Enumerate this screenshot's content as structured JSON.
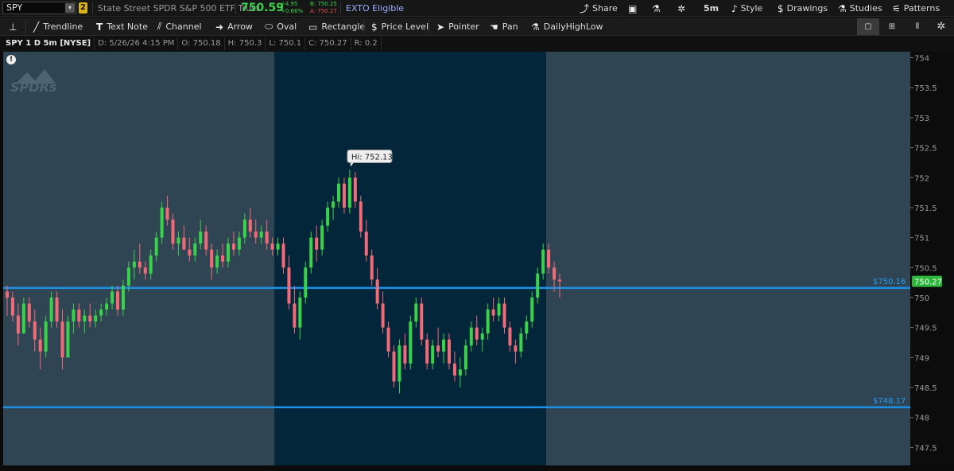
{
  "header": {
    "symbol": "SPY",
    "link_group": "2",
    "description": "State Street SPDR S&P 500 ETF Trust",
    "last_price": "750.59",
    "net_change": "+4.95",
    "pct_change": "+0.66%",
    "bid": "B: 750.25",
    "ask": "A: 750.27",
    "exto": "EXTO Eligible",
    "buttons": {
      "share": "Share",
      "timeframe": "5m",
      "style": "Style",
      "drawings": "Drawings",
      "studies": "Studies",
      "patterns": "Patterns"
    }
  },
  "drawing_tools": [
    {
      "name": "pin-tool",
      "icon": "pin-icon",
      "label": ""
    },
    {
      "name": "trendline-tool",
      "icon": "trendline-icon",
      "label": "Trendline"
    },
    {
      "name": "text-note-tool",
      "icon": "text-icon",
      "label": "Text Note"
    },
    {
      "name": "channel-tool",
      "icon": "channel-icon",
      "label": "Channel"
    },
    {
      "name": "arrow-tool",
      "icon": "arrow-icon",
      "label": "Arrow"
    },
    {
      "name": "oval-tool",
      "icon": "oval-icon",
      "label": "Oval"
    },
    {
      "name": "rectangle-tool",
      "icon": "rectangle-icon",
      "label": "Rectangle"
    },
    {
      "name": "price-level-tool",
      "icon": "dollar-icon",
      "label": "Price Level"
    },
    {
      "name": "pointer-tool",
      "icon": "pointer-icon",
      "label": "Pointer"
    },
    {
      "name": "pan-tool",
      "icon": "hand-icon",
      "label": "Pan"
    },
    {
      "name": "dailyhighlow-tool",
      "icon": "flask-icon",
      "label": "DailyHighLow"
    }
  ],
  "info": {
    "title": "SPY 1 D 5m [NYSE]",
    "date": "D: 5/26/26 4:15 PM",
    "open": "O: 750.18",
    "high": "H: 750.3",
    "low": "L: 750.1",
    "close": "C: 750.27",
    "range": "R: 0.2"
  },
  "chart_data": {
    "type": "candlestick",
    "y_ticks": [
      "754",
      "753.5",
      "753",
      "752.5",
      "752",
      "751.5",
      "751",
      "750.5",
      "750",
      "749.5",
      "749",
      "748.5",
      "748",
      "747.5"
    ],
    "ylim": [
      747.2,
      754.1
    ],
    "current_price_label": "750.27",
    "high_marker": "Hi: 752.13",
    "price_levels": [
      {
        "label": "$750.16",
        "value": 750.16
      },
      {
        "label": "$748.17",
        "value": 748.17
      }
    ],
    "session_colors": {
      "extended": "#2f4553",
      "regular": "#03263a"
    },
    "up_color": "#3ad24a",
    "down_color": "#f06a78",
    "level_color": "#1e90e6",
    "candles": [
      [
        750.1,
        750.2,
        749.7,
        750.0
      ],
      [
        750.0,
        750.1,
        749.6,
        749.7
      ],
      [
        749.7,
        749.9,
        749.2,
        749.4
      ],
      [
        749.4,
        750.0,
        749.4,
        749.9
      ],
      [
        749.9,
        750.0,
        749.5,
        749.6
      ],
      [
        749.6,
        749.8,
        749.1,
        749.3
      ],
      [
        749.3,
        749.5,
        748.8,
        749.1
      ],
      [
        749.1,
        749.7,
        749.0,
        749.6
      ],
      [
        749.6,
        750.1,
        749.5,
        750.0
      ],
      [
        750.0,
        750.1,
        749.5,
        749.6
      ],
      [
        749.6,
        749.8,
        748.8,
        749.0
      ],
      [
        749.0,
        749.7,
        749.0,
        749.6
      ],
      [
        749.6,
        749.9,
        749.4,
        749.8
      ],
      [
        749.8,
        749.9,
        749.5,
        749.6
      ],
      [
        749.6,
        749.8,
        749.4,
        749.7
      ],
      [
        749.7,
        749.9,
        749.5,
        749.6
      ],
      [
        749.6,
        749.8,
        749.5,
        749.7
      ],
      [
        749.7,
        749.9,
        749.6,
        749.8
      ],
      [
        749.8,
        750.0,
        749.7,
        749.9
      ],
      [
        749.9,
        750.2,
        749.8,
        750.1
      ],
      [
        750.1,
        750.2,
        749.7,
        749.8
      ],
      [
        749.8,
        750.3,
        749.7,
        750.2
      ],
      [
        750.2,
        750.6,
        750.1,
        750.5
      ],
      [
        750.5,
        750.8,
        750.3,
        750.6
      ],
      [
        750.6,
        750.9,
        750.4,
        750.5
      ],
      [
        750.5,
        750.6,
        750.3,
        750.4
      ],
      [
        750.4,
        750.8,
        750.3,
        750.7
      ],
      [
        750.7,
        751.1,
        750.6,
        751.0
      ],
      [
        751.0,
        751.6,
        750.9,
        751.5
      ],
      [
        751.5,
        751.7,
        751.2,
        751.3
      ],
      [
        751.3,
        751.4,
        750.8,
        750.9
      ],
      [
        750.9,
        751.1,
        750.7,
        751.0
      ],
      [
        751.0,
        751.2,
        750.8,
        750.8
      ],
      [
        750.8,
        751.0,
        750.6,
        750.7
      ],
      [
        750.7,
        751.0,
        750.6,
        750.9
      ],
      [
        750.9,
        751.3,
        750.8,
        751.1
      ],
      [
        751.1,
        751.2,
        750.7,
        750.8
      ],
      [
        750.8,
        750.9,
        750.3,
        750.5
      ],
      [
        750.5,
        750.8,
        750.4,
        750.7
      ],
      [
        750.7,
        750.9,
        750.5,
        750.6
      ],
      [
        750.6,
        751.0,
        750.5,
        750.9
      ],
      [
        750.9,
        751.1,
        750.7,
        750.8
      ],
      [
        750.8,
        751.1,
        750.7,
        751.0
      ],
      [
        751.0,
        751.4,
        750.9,
        751.3
      ],
      [
        751.3,
        751.5,
        751.0,
        751.1
      ],
      [
        751.1,
        751.3,
        750.9,
        751.0
      ],
      [
        751.0,
        751.2,
        750.9,
        751.1
      ],
      [
        751.1,
        751.3,
        750.8,
        750.9
      ],
      [
        750.9,
        751.0,
        750.7,
        750.8
      ],
      [
        750.8,
        751.0,
        750.7,
        750.9
      ],
      [
        750.9,
        751.0,
        750.4,
        750.5
      ],
      [
        750.5,
        750.7,
        749.8,
        749.9
      ],
      [
        749.9,
        750.2,
        749.4,
        749.5
      ],
      [
        749.5,
        750.1,
        749.3,
        750.0
      ],
      [
        750.0,
        750.6,
        749.9,
        750.5
      ],
      [
        750.5,
        751.1,
        750.4,
        751.0
      ],
      [
        751.0,
        751.2,
        750.6,
        750.8
      ],
      [
        750.8,
        751.3,
        750.7,
        751.2
      ],
      [
        751.2,
        751.6,
        751.1,
        751.5
      ],
      [
        751.5,
        751.7,
        751.3,
        751.6
      ],
      [
        751.6,
        752.0,
        751.5,
        751.9
      ],
      [
        751.9,
        752.0,
        751.4,
        751.5
      ],
      [
        751.5,
        752.13,
        751.4,
        752.0
      ],
      [
        752.0,
        752.1,
        751.5,
        751.6
      ],
      [
        751.6,
        751.7,
        751.0,
        751.1
      ],
      [
        751.1,
        751.3,
        750.6,
        750.7
      ],
      [
        750.7,
        750.8,
        750.2,
        750.3
      ],
      [
        750.3,
        750.5,
        749.8,
        749.9
      ],
      [
        749.9,
        750.1,
        749.4,
        749.5
      ],
      [
        749.5,
        749.6,
        749.0,
        749.1
      ],
      [
        749.1,
        749.2,
        748.5,
        748.6
      ],
      [
        748.6,
        749.3,
        748.4,
        749.2
      ],
      [
        749.2,
        749.4,
        748.8,
        748.9
      ],
      [
        748.9,
        749.7,
        748.8,
        749.6
      ],
      [
        749.6,
        750.0,
        749.5,
        749.9
      ],
      [
        749.9,
        750.0,
        749.2,
        749.3
      ],
      [
        749.3,
        749.4,
        748.8,
        748.9
      ],
      [
        748.9,
        749.3,
        748.8,
        749.2
      ],
      [
        749.2,
        749.5,
        749.0,
        749.1
      ],
      [
        749.1,
        749.4,
        748.9,
        749.3
      ],
      [
        749.3,
        749.4,
        748.8,
        748.9
      ],
      [
        748.9,
        749.1,
        748.6,
        748.7
      ],
      [
        748.7,
        749.0,
        748.5,
        748.8
      ],
      [
        748.8,
        749.3,
        748.7,
        749.2
      ],
      [
        749.2,
        749.6,
        749.1,
        749.5
      ],
      [
        749.5,
        749.7,
        749.2,
        749.3
      ],
      [
        749.3,
        749.5,
        749.1,
        749.4
      ],
      [
        749.4,
        749.9,
        749.3,
        749.8
      ],
      [
        749.8,
        750.0,
        749.6,
        749.7
      ],
      [
        749.7,
        750.0,
        749.6,
        749.9
      ],
      [
        749.9,
        750.0,
        749.4,
        749.5
      ],
      [
        749.5,
        749.6,
        749.1,
        749.2
      ],
      [
        749.2,
        749.3,
        748.9,
        749.1
      ],
      [
        749.1,
        749.5,
        749.0,
        749.4
      ],
      [
        749.4,
        749.7,
        749.3,
        749.6
      ],
      [
        749.6,
        750.1,
        749.5,
        750.0
      ],
      [
        750.0,
        750.5,
        749.9,
        750.4
      ],
      [
        750.4,
        750.9,
        750.3,
        750.8
      ],
      [
        750.8,
        750.9,
        750.4,
        750.5
      ],
      [
        750.5,
        750.6,
        750.1,
        750.3
      ],
      [
        750.3,
        750.4,
        750.0,
        750.27
      ]
    ]
  }
}
